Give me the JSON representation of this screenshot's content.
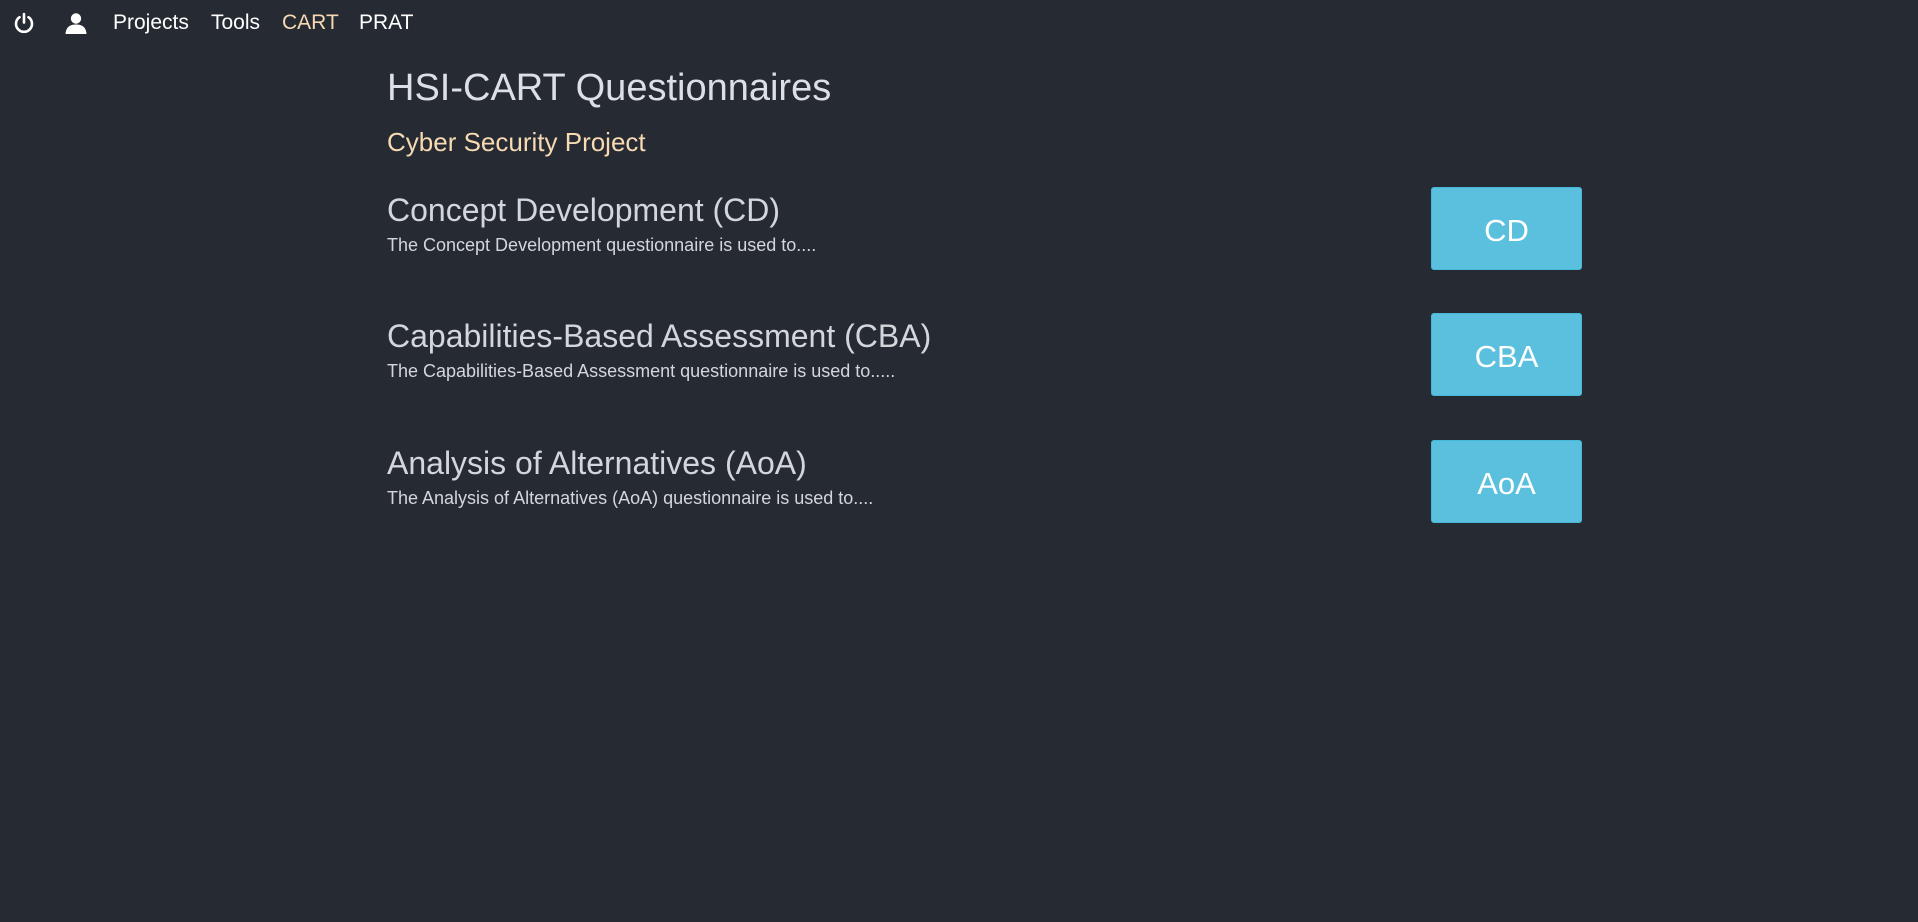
{
  "nav": {
    "icons": [
      "power-icon",
      "user-icon"
    ],
    "links": [
      {
        "label": "Projects",
        "active": false
      },
      {
        "label": "Tools",
        "active": false
      },
      {
        "label": "CART",
        "active": true
      },
      {
        "label": "PRAT",
        "active": false
      }
    ],
    "active_color": "#f7d9b2"
  },
  "page": {
    "title": "HSI-CART Questionnaires",
    "project": "Cyber Security Project"
  },
  "questionnaires": [
    {
      "title": "Concept Development (CD)",
      "description": "The Concept Development questionnaire is used to....",
      "button": "CD"
    },
    {
      "title": "Capabilities-Based Assessment (CBA)",
      "description": "The Capabilities-Based Assessment questionnaire is used to.....",
      "button": "CBA"
    },
    {
      "title": "Analysis of Alternatives (AoA)",
      "description": "The Analysis of Alternatives (AoA) questionnaire is used to....",
      "button": "AoA"
    }
  ],
  "colors": {
    "background": "#262a33",
    "button": "#5bc0de",
    "accent": "#f7d9b2"
  }
}
